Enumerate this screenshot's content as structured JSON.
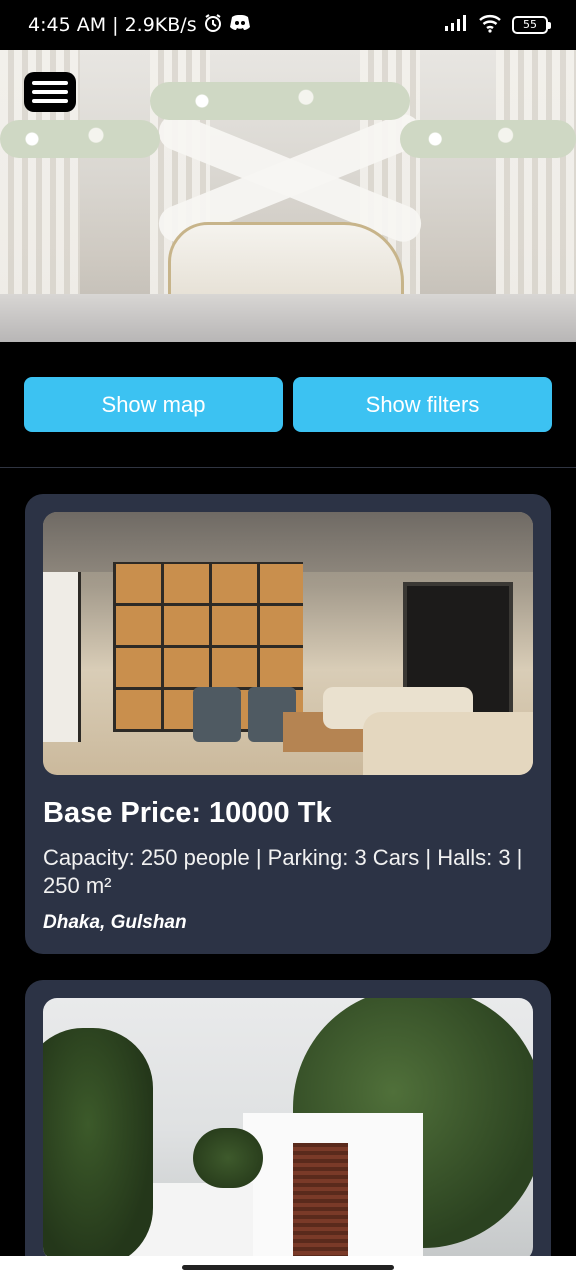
{
  "status_bar": {
    "time_speed": "4:45 AM | 2.9KB/s",
    "battery": "55",
    "icons": [
      "alarm-icon",
      "discord-icon",
      "signal-icon",
      "wifi-icon",
      "battery-icon"
    ]
  },
  "hero": {
    "image": "wedding-stage-decor-image",
    "menu_icon": "hamburger-menu-icon"
  },
  "actions": {
    "show_map": "Show map",
    "show_filters": "Show filters"
  },
  "colors": {
    "accent": "#3cc2f2",
    "card_bg": "#2c3345",
    "page_bg": "#000000"
  },
  "listings": [
    {
      "image": "modern-lounge-interior-image",
      "price": "Base Price: 10000 Tk",
      "details": "Capacity: 250 people | Parking: 3 Cars | Halls: 3 | 250 m²",
      "location": "Dhaka, Gulshan"
    },
    {
      "image": "white-villa-exterior-image"
    }
  ]
}
